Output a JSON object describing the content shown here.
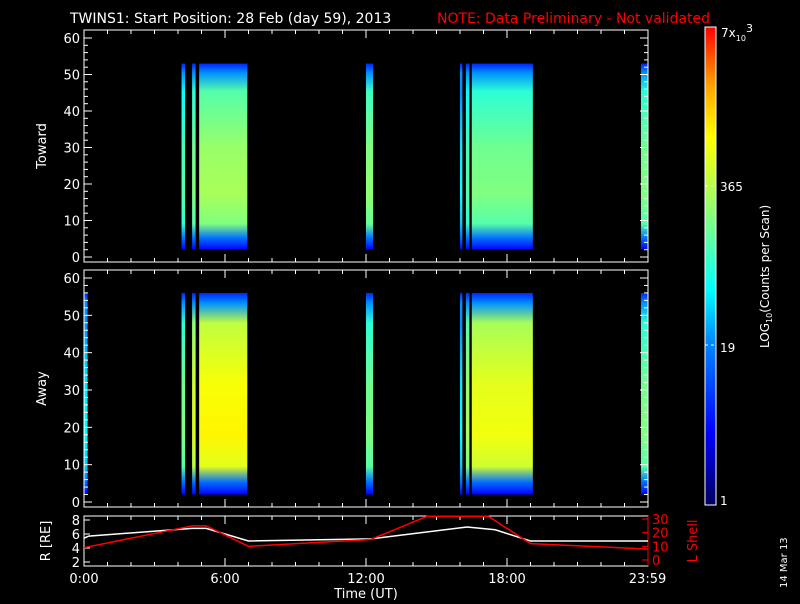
{
  "title": {
    "main": "TWINS1: Start Position: 28 Feb (day  59), 2013",
    "note": "NOTE: Data Preliminary - Not validated"
  },
  "date_stamp": "14 Mar 13",
  "colors": {
    "note": "#ff0000",
    "axes": "#ffffff",
    "lshell": "#ff0000",
    "radius": "#ffffff"
  },
  "chart_data": [
    {
      "type": "heatmap",
      "panel": "toward",
      "ylabel": "Toward",
      "ylim": [
        0,
        63
      ],
      "yticks": [
        "0",
        "10",
        "20",
        "30",
        "40",
        "50",
        "60"
      ],
      "xlim": [
        0,
        24
      ],
      "intervals": [
        {
          "start": 4.15,
          "end": 4.3,
          "level": 0.55
        },
        {
          "start": 4.6,
          "end": 4.75,
          "level": 0.6
        },
        {
          "start": 4.9,
          "end": 6.95,
          "level": 0.65
        },
        {
          "start": 12.0,
          "end": 12.3,
          "level": 0.62
        },
        {
          "start": 16.0,
          "end": 16.1,
          "level": 0.45
        },
        {
          "start": 16.25,
          "end": 16.4,
          "level": 0.55
        },
        {
          "start": 16.5,
          "end": 19.1,
          "level": 0.6
        },
        {
          "start": 23.7,
          "end": 24.0,
          "level": 0.6
        }
      ],
      "energy_range": [
        2,
        53
      ]
    },
    {
      "type": "heatmap",
      "panel": "away",
      "ylabel": "Away",
      "ylim": [
        0,
        63
      ],
      "yticks": [
        "0",
        "10",
        "20",
        "30",
        "40",
        "50",
        "60"
      ],
      "xlim": [
        0,
        24
      ],
      "intervals": [
        {
          "start": 0.0,
          "end": 0.15,
          "level": 0.45
        },
        {
          "start": 4.15,
          "end": 4.3,
          "level": 0.6
        },
        {
          "start": 4.6,
          "end": 4.75,
          "level": 0.72
        },
        {
          "start": 4.9,
          "end": 6.95,
          "level": 0.78
        },
        {
          "start": 12.0,
          "end": 12.3,
          "level": 0.6
        },
        {
          "start": 16.0,
          "end": 16.1,
          "level": 0.45
        },
        {
          "start": 16.25,
          "end": 16.4,
          "level": 0.65
        },
        {
          "start": 16.5,
          "end": 19.1,
          "level": 0.75
        },
        {
          "start": 23.7,
          "end": 24.0,
          "level": 0.6
        }
      ],
      "energy_range": [
        2,
        56
      ]
    },
    {
      "type": "line",
      "panel": "ephemeris",
      "ylabel": "R [RE]",
      "y2label": "L Shell",
      "xlabel": "Time (UT)",
      "xticks": [
        "0:00",
        "6:00",
        "12:00",
        "18:00",
        "23:59"
      ],
      "ylim": [
        2,
        8
      ],
      "yticks": [
        "2",
        "4",
        "6",
        "8"
      ],
      "y2lim": [
        0,
        30
      ],
      "y2ticks": [
        "0",
        "10",
        "20",
        "30"
      ],
      "series": [
        {
          "name": "R",
          "axis": "left",
          "x": [
            0,
            0.2,
            4.6,
            5.2,
            7.0,
            12.2,
            16.3,
            17.5,
            19.0,
            24
          ],
          "y": [
            5.4,
            5.7,
            6.8,
            6.8,
            5.0,
            5.3,
            7.0,
            6.6,
            5.0,
            5.0
          ]
        },
        {
          "name": "L Shell",
          "axis": "right",
          "x": [
            0,
            4.6,
            5.2,
            7.0,
            12.2,
            14.6,
            17.2,
            19.0,
            24
          ],
          "y": [
            9,
            25,
            25,
            10,
            15,
            32,
            32,
            12,
            8
          ]
        }
      ]
    },
    {
      "type": "colorbar",
      "label": "LOG10(Counts per Scan)",
      "ticks": [
        "1",
        "19",
        "365",
        "7x10^3"
      ],
      "tick_labels": {
        "min": "1",
        "t1": "19",
        "t2": "365",
        "max_base": "7x",
        "max_sub": "10",
        "max_exp": "3"
      },
      "label_parts": {
        "pre": "LOG",
        "sub": "10",
        "post": "(Counts per Scan)"
      }
    }
  ]
}
